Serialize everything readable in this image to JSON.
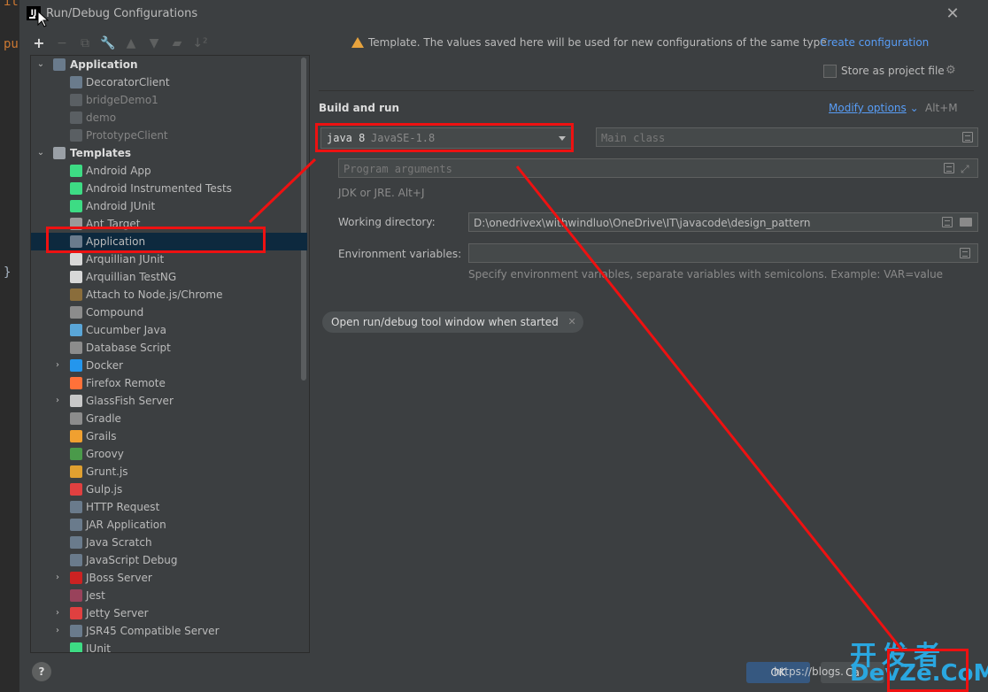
{
  "editor": {
    "code_lines": [
      "it",
      "pu",
      "}"
    ]
  },
  "window": {
    "title": "Run/Debug Configurations",
    "close": "✕",
    "app_icon": "IJ"
  },
  "toolbar": [
    {
      "name": "add-icon",
      "glyph": "+",
      "enabled": true
    },
    {
      "name": "remove-icon",
      "glyph": "−",
      "enabled": false
    },
    {
      "name": "copy-icon",
      "glyph": "⧉",
      "enabled": false
    },
    {
      "name": "wrench-icon",
      "glyph": "🔧",
      "enabled": false
    },
    {
      "name": "move-up-icon",
      "glyph": "▲",
      "enabled": false
    },
    {
      "name": "move-down-icon",
      "glyph": "▼",
      "enabled": false
    },
    {
      "name": "folder-icon",
      "glyph": "▰",
      "enabled": false
    },
    {
      "name": "sort-icon",
      "glyph": "↓²",
      "enabled": false
    }
  ],
  "tree": [
    {
      "label": "Application",
      "bold": true,
      "arrow": "⌄",
      "indent": 0,
      "icon": "application-icon",
      "color": "#6a7b8c"
    },
    {
      "label": "DecoratorClient",
      "indent": 1,
      "icon": "class-icon",
      "color": "#6a7b8c"
    },
    {
      "label": "bridgeDemo1",
      "indent": 1,
      "icon": "class-icon",
      "color": "#5a5f63",
      "dim": true
    },
    {
      "label": "demo",
      "indent": 1,
      "icon": "class-icon",
      "color": "#5a5f63",
      "dim": true
    },
    {
      "label": "PrototypeClient",
      "indent": 1,
      "icon": "class-icon",
      "color": "#5a5f63",
      "dim": true
    },
    {
      "label": "Templates",
      "bold": true,
      "arrow": "⌄",
      "indent": 0,
      "icon": "wrench-icon",
      "color": "#9aa0a6"
    },
    {
      "label": "Android App",
      "indent": 1,
      "icon": "android-icon",
      "color": "#3ddc84"
    },
    {
      "label": "Android Instrumented Tests",
      "indent": 1,
      "icon": "android-icon",
      "color": "#3ddc84"
    },
    {
      "label": "Android JUnit",
      "indent": 1,
      "icon": "android-icon",
      "color": "#3ddc84"
    },
    {
      "label": "Ant Target",
      "indent": 1,
      "icon": "ant-icon",
      "color": "#9a9a9a"
    },
    {
      "label": "Application",
      "indent": 1,
      "icon": "application-icon",
      "color": "#6a7b8c",
      "selected": true
    },
    {
      "label": "Arquillian JUnit",
      "indent": 1,
      "icon": "arquillian-icon",
      "color": "#d8d8d8"
    },
    {
      "label": "Arquillian TestNG",
      "indent": 1,
      "icon": "arquillian-icon",
      "color": "#d8d8d8"
    },
    {
      "label": "Attach to Node.js/Chrome",
      "indent": 1,
      "icon": "nodejs-icon",
      "color": "#8a6d3b"
    },
    {
      "label": "Compound",
      "indent": 1,
      "icon": "compound-icon",
      "color": "#8c8c8c"
    },
    {
      "label": "Cucumber Java",
      "indent": 1,
      "icon": "cucumber-icon",
      "color": "#5aa6d8"
    },
    {
      "label": "Database Script",
      "indent": 1,
      "icon": "database-icon",
      "color": "#8c8c8c"
    },
    {
      "label": "Docker",
      "indent": 1,
      "arrow": "›",
      "icon": "docker-icon",
      "color": "#2496ed"
    },
    {
      "label": "Firefox Remote",
      "indent": 1,
      "icon": "firefox-icon",
      "color": "#ff7139"
    },
    {
      "label": "GlassFish Server",
      "indent": 1,
      "arrow": "›",
      "icon": "glassfish-icon",
      "color": "#c8c8c8"
    },
    {
      "label": "Gradle",
      "indent": 1,
      "icon": "gradle-icon",
      "color": "#8c8c8c"
    },
    {
      "label": "Grails",
      "indent": 1,
      "icon": "grails-icon",
      "color": "#f0a030"
    },
    {
      "label": "Groovy",
      "indent": 1,
      "icon": "groovy-icon",
      "color": "#4a9a4a"
    },
    {
      "label": "Grunt.js",
      "indent": 1,
      "icon": "grunt-icon",
      "color": "#e0a030"
    },
    {
      "label": "Gulp.js",
      "indent": 1,
      "icon": "gulp-icon",
      "color": "#e04040"
    },
    {
      "label": "HTTP Request",
      "indent": 1,
      "icon": "http-icon",
      "color": "#6a7b8c"
    },
    {
      "label": "JAR Application",
      "indent": 1,
      "icon": "jar-icon",
      "color": "#6a7b8c"
    },
    {
      "label": "Java Scratch",
      "indent": 1,
      "icon": "scratch-icon",
      "color": "#6a7b8c"
    },
    {
      "label": "JavaScript Debug",
      "indent": 1,
      "icon": "js-debug-icon",
      "color": "#6a7b8c"
    },
    {
      "label": "JBoss Server",
      "indent": 1,
      "arrow": "›",
      "icon": "jboss-icon",
      "color": "#cc2222"
    },
    {
      "label": "Jest",
      "indent": 1,
      "icon": "jest-icon",
      "color": "#99425b"
    },
    {
      "label": "Jetty Server",
      "indent": 1,
      "arrow": "›",
      "icon": "jetty-icon",
      "color": "#e04040"
    },
    {
      "label": "JSR45 Compatible Server",
      "indent": 1,
      "arrow": "›",
      "icon": "jsr45-icon",
      "color": "#6a7b8c"
    },
    {
      "label": "JUnit",
      "indent": 1,
      "icon": "junit-icon",
      "color": "#3ddc84"
    }
  ],
  "right": {
    "warning": "Template. The values saved here will be used for new configurations of the same type",
    "create_link": "Create configuration",
    "store_label": "Store as project file",
    "section": "Build and run",
    "modify_link": "Modify options",
    "modify_shortcut": "Alt+M",
    "jdk_value": "java 8",
    "jdk_detail": "JavaSE-1.8",
    "main_class_placeholder": "Main class",
    "program_args_placeholder": "Program arguments",
    "jdk_hint": "JDK or JRE. Alt+J",
    "working_dir_label": "Working directory:",
    "working_dir_value": "D:\\onedrivex\\withwindluo\\OneDrive\\IT\\javacode\\design_pattern",
    "env_label": "Environment variables:",
    "env_hint": "Specify environment variables, separate variables with semicolons. Example: VAR=value",
    "chip_label": "Open run/debug tool window when started",
    "chip_close": "✕"
  },
  "footer": {
    "help": "?",
    "ok": "OK",
    "cancel": "Ca",
    "watermark": "https://blogs.",
    "logo_top": "开发者",
    "logo_bottom": "DevZe.CoM"
  },
  "colors": {
    "annotation": "#ee1111",
    "link": "#589df6",
    "selection": "#0d293e"
  }
}
